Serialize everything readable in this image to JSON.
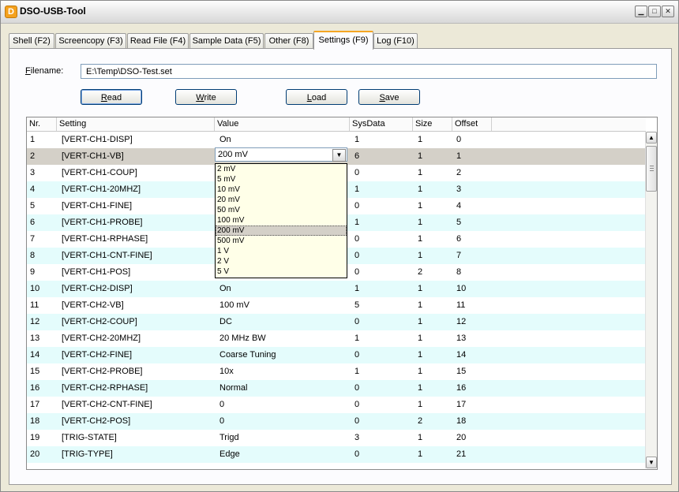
{
  "window": {
    "title": "DSO-USB-Tool",
    "icon_letter": "D"
  },
  "tabs": [
    {
      "label": "Shell (F2)",
      "active": false
    },
    {
      "label": "Screencopy (F3)",
      "active": false
    },
    {
      "label": "Read File (F4)",
      "active": false
    },
    {
      "label": "Sample Data (F5)",
      "active": false
    },
    {
      "label": "Other (F8)",
      "active": false
    },
    {
      "label": "Settings (F9)",
      "active": true
    },
    {
      "label": "Log (F10)",
      "active": false
    }
  ],
  "filename": {
    "label_first": "F",
    "label_rest": "ilename:",
    "value": "E:\\Temp\\DSO-Test.set"
  },
  "buttons": {
    "read": {
      "first": "R",
      "rest": "ead"
    },
    "write": {
      "first": "W",
      "rest": "rite"
    },
    "load": {
      "first": "L",
      "rest": "oad"
    },
    "save": {
      "first": "S",
      "rest": "ave"
    }
  },
  "table": {
    "headers": [
      "Nr.",
      "Setting",
      "Value",
      "SysData",
      "Size",
      "Offset"
    ],
    "rows": [
      [
        "1",
        "[VERT-CH1-DISP]",
        "On",
        "1",
        "1",
        "0"
      ],
      [
        "2",
        "[VERT-CH1-VB]",
        "200 mV",
        "6",
        "1",
        "1"
      ],
      [
        "3",
        "[VERT-CH1-COUP]",
        "",
        "0",
        "1",
        "2"
      ],
      [
        "4",
        "[VERT-CH1-20MHZ]",
        "",
        "1",
        "1",
        "3"
      ],
      [
        "5",
        "[VERT-CH1-FINE]",
        "",
        "0",
        "1",
        "4"
      ],
      [
        "6",
        "[VERT-CH1-PROBE]",
        "",
        "1",
        "1",
        "5"
      ],
      [
        "7",
        "[VERT-CH1-RPHASE]",
        "",
        "0",
        "1",
        "6"
      ],
      [
        "8",
        "[VERT-CH1-CNT-FINE]",
        "",
        "0",
        "1",
        "7"
      ],
      [
        "9",
        "[VERT-CH1-POS]",
        "",
        "0",
        "2",
        "8"
      ],
      [
        "10",
        "[VERT-CH2-DISP]",
        "On",
        "1",
        "1",
        "10"
      ],
      [
        "11",
        "[VERT-CH2-VB]",
        "100 mV",
        "5",
        "1",
        "11"
      ],
      [
        "12",
        "[VERT-CH2-COUP]",
        "DC",
        "0",
        "1",
        "12"
      ],
      [
        "13",
        "[VERT-CH2-20MHZ]",
        "20 MHz BW",
        "1",
        "1",
        "13"
      ],
      [
        "14",
        "[VERT-CH2-FINE]",
        "Coarse Tuning",
        "0",
        "1",
        "14"
      ],
      [
        "15",
        "[VERT-CH2-PROBE]",
        "10x",
        "1",
        "1",
        "15"
      ],
      [
        "16",
        "[VERT-CH2-RPHASE]",
        "Normal",
        "0",
        "1",
        "16"
      ],
      [
        "17",
        "[VERT-CH2-CNT-FINE]",
        "0",
        "0",
        "1",
        "17"
      ],
      [
        "18",
        "[VERT-CH2-POS]",
        "0",
        "0",
        "2",
        "18"
      ],
      [
        "19",
        "[TRIG-STATE]",
        "Trigd",
        "3",
        "1",
        "20"
      ],
      [
        "20",
        "[TRIG-TYPE]",
        "Edge",
        "0",
        "1",
        "21"
      ]
    ],
    "selected_row": 2,
    "combo_value": "200 mV",
    "dropdown_options": [
      "2 mV",
      "5 mV",
      "10 mV",
      "20 mV",
      "50 mV",
      "100 mV",
      "200 mV",
      "500 mV",
      "1 V",
      "2 V",
      "5 V"
    ],
    "dropdown_highlighted": "200 mV"
  },
  "colors": {
    "alt_row": "#e4fcfc",
    "selected_row": "#d4d0c8",
    "dropdown_bg": "#ffffe8",
    "active_tab_accent": "#f5a623"
  }
}
